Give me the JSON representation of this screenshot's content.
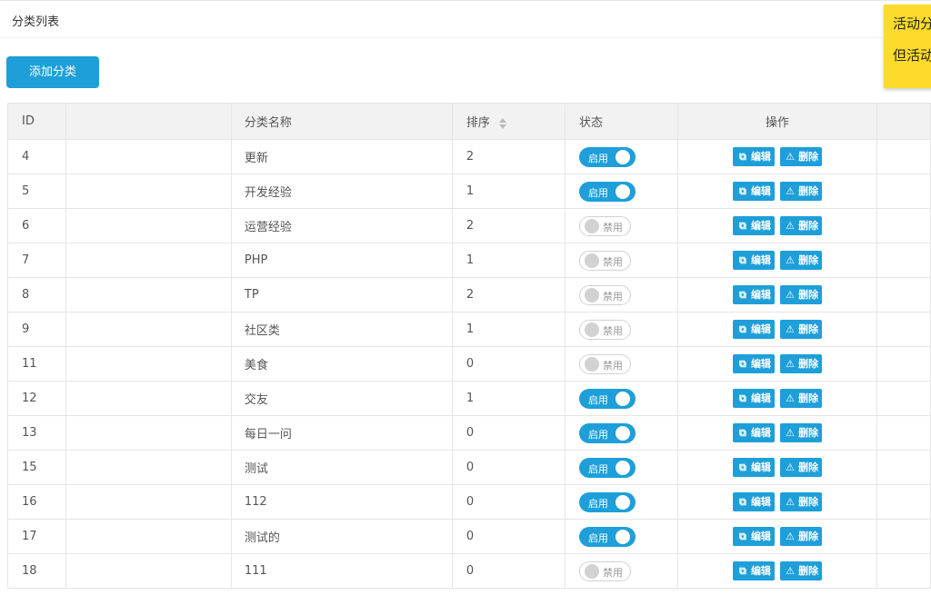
{
  "header": {
    "title": "分类列表"
  },
  "toolbar": {
    "add_label": "添加分类"
  },
  "notice": {
    "line1": "活动分",
    "line2": "但活动"
  },
  "table": {
    "columns": {
      "id": "ID",
      "name": "分类名称",
      "sort": "排序",
      "status": "状态",
      "ops": "操作"
    },
    "edit_label": "编辑",
    "delete_label": "删除",
    "rows": [
      {
        "id": "4",
        "name": "更新",
        "sort": "2",
        "enabled": true
      },
      {
        "id": "5",
        "name": "开发经验",
        "sort": "1",
        "enabled": true
      },
      {
        "id": "6",
        "name": "运营经验",
        "sort": "2",
        "enabled": false
      },
      {
        "id": "7",
        "name": "PHP",
        "sort": "1",
        "enabled": false
      },
      {
        "id": "8",
        "name": "TP",
        "sort": "2",
        "enabled": false
      },
      {
        "id": "9",
        "name": "社区类",
        "sort": "1",
        "enabled": false
      },
      {
        "id": "11",
        "name": "美食",
        "sort": "0",
        "enabled": false
      },
      {
        "id": "12",
        "name": "交友",
        "sort": "1",
        "enabled": true
      },
      {
        "id": "13",
        "name": "每日一问",
        "sort": "0",
        "enabled": true
      },
      {
        "id": "15",
        "name": "测试",
        "sort": "0",
        "enabled": true
      },
      {
        "id": "16",
        "name": "112",
        "sort": "0",
        "enabled": true
      },
      {
        "id": "17",
        "name": "测试的",
        "sort": "0",
        "enabled": true
      },
      {
        "id": "18",
        "name": "111",
        "sort": "0",
        "enabled": false
      }
    ]
  },
  "switch_labels": {
    "on": "启用",
    "off": "禁用"
  },
  "colors": {
    "accent": "#1e9fd9",
    "notice_bg": "#fddb2a"
  }
}
